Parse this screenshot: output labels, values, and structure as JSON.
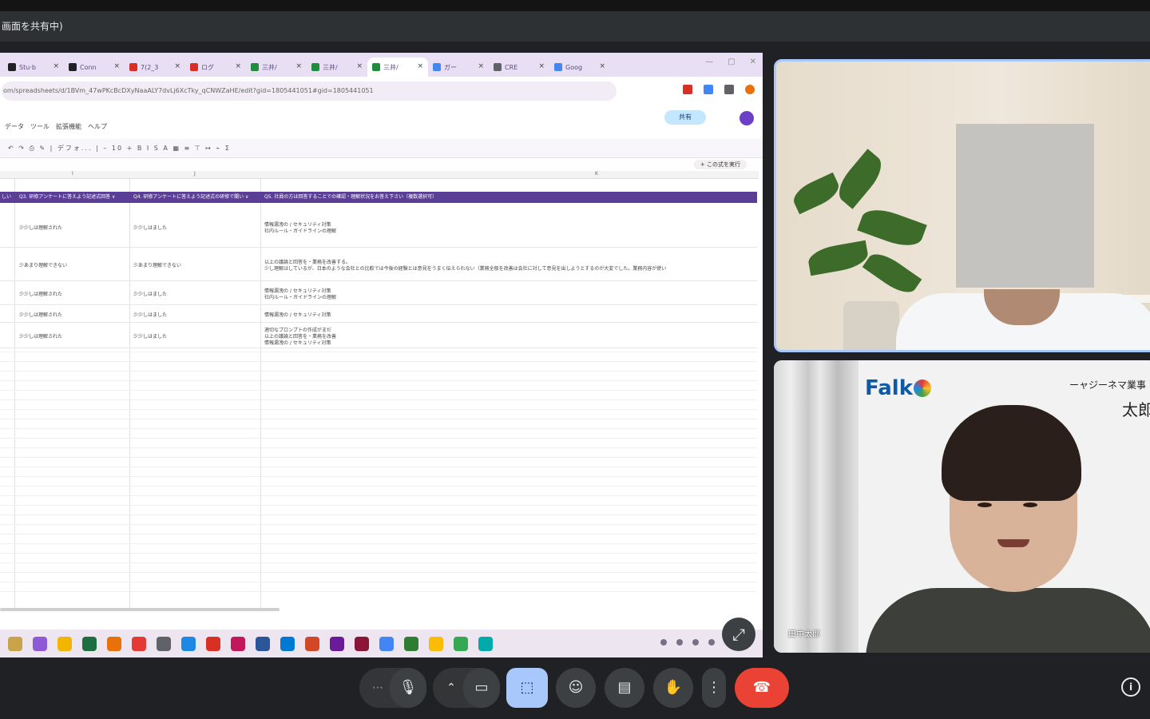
{
  "share_banner": {
    "text": "画面を共有中)"
  },
  "browser": {
    "tabs": [
      {
        "label": "Stu·b",
        "color": "#202124"
      },
      {
        "label": "Conn",
        "color": "#202124"
      },
      {
        "label": "7(2_3",
        "color": "#d93025"
      },
      {
        "label": "ログ",
        "color": "#d93025"
      },
      {
        "label": "三井/",
        "color": "#1e8e3e"
      },
      {
        "label": "三井/",
        "color": "#1e8e3e"
      },
      {
        "label": "三井/",
        "color": "#1e8e3e"
      },
      {
        "label": "ガー",
        "color": "#4285f4"
      },
      {
        "label": "CRE",
        "color": "#5f6368"
      },
      {
        "label": "Goog",
        "color": "#4285f4"
      }
    ],
    "url": "om/spreadsheets/d/1BVm_47wPKcBcDXyNaaALY7dvLj6XcTky_qCNWZaHE/edit?gid=1805441051#gid=1805441051"
  },
  "sheet": {
    "menu": "データ　ツール　拡張機能　ヘルプ",
    "font_name": "デフォ...",
    "font_size": "10",
    "share_label": "共有",
    "formula_button": "+ この式を実行",
    "col_markers": [
      "I",
      "J",
      "K"
    ],
    "headers": [
      "しい",
      "Q3. 研修アンケートに答えよう記述式回答 ∨",
      "Q4. 研修アンケートに答えよう記述式の研修で聞い ∨",
      "Q5. 社員の方は回答することでの確認・理解状況をお答え下さい（複数選択可）"
    ],
    "rows": [
      {
        "c1": "少少しは理解された",
        "c2": "少少しはました",
        "c3": [
          "情報漏洩の / セキュリティ対策",
          "社内ルール・ガイドラインの理解"
        ]
      },
      {
        "c1": "少あまり理解できない",
        "c2": "少あまり理解できない",
        "c3": [
          "以上の議論と回答を・業務を改善する。",
          "少し理解はしているが、日本のような会社との比較では今後の経験とは意見をうまく伝えられない（業務全般を改善は会社に対して意見を出しようとするのが大変でした。業務内容が使い"
        ]
      },
      {
        "c1": "少少しは理解された",
        "c2": "少少しはました",
        "c3": [
          "情報漏洩の / セキュリティ対策",
          "社内ルール・ガイドラインの理解"
        ]
      },
      {
        "c1": "少少しは理解された",
        "c2": "少少しはました",
        "c3": [
          "情報漏洩の / セキュリティ対策"
        ]
      },
      {
        "c1": "少少しは理解された",
        "c2": "少少しはました",
        "c3": [
          "適切なプロンプトの作成がまだ",
          "以上の議論と回答を・業務を改善",
          "情報漏洩の / セキュリティ対策"
        ]
      }
    ]
  },
  "participants": {
    "presenter_name": "田中太郎",
    "presenter_banner_line1": "ーャジーネマ業事",
    "presenter_banner_line2": "太郎",
    "logo_text": "Falk"
  },
  "controls": {
    "more_label": "⋯",
    "mic_label": "🎙",
    "chevron_label": "⌃",
    "camera_label": "▭",
    "present_label": "⬚",
    "emoji_label": "☺",
    "captions_label": "▤",
    "hand_label": "✋",
    "overflow_label": "⋮",
    "leave_label": "☎",
    "info_label": "i",
    "expand_label": "⤢",
    "accent_present": "#a8c7fa",
    "accent_leave": "#ea4335"
  }
}
